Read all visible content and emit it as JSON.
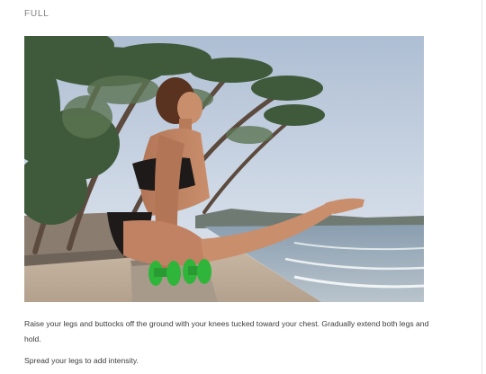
{
  "section": {
    "label": "FULL"
  },
  "exercise": {
    "image_alt": "Woman balancing on two green dumbbells in a tucked L-sit pose on a beach boardwalk with palm trees",
    "description": "Raise your legs and buttocks off the ground with your knees tucked toward your chest. Gradually extend both legs and hold.",
    "tip": "Spread your legs to add intensity."
  },
  "colors": {
    "label": "#808080",
    "body_text": "#3b3b3b",
    "dumbbell": "#2fb53a"
  }
}
